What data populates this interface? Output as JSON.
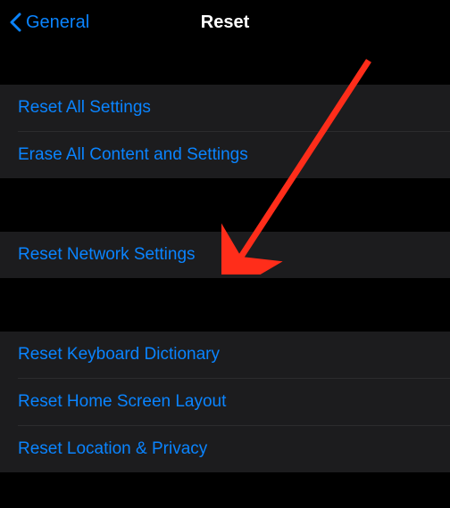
{
  "nav": {
    "back_label": "General",
    "title": "Reset"
  },
  "groups": [
    {
      "items": [
        {
          "label": "Reset All Settings"
        },
        {
          "label": "Erase All Content and Settings"
        }
      ]
    },
    {
      "items": [
        {
          "label": "Reset Network Settings"
        }
      ]
    },
    {
      "items": [
        {
          "label": "Reset Keyboard Dictionary"
        },
        {
          "label": "Reset Home Screen Layout"
        },
        {
          "label": "Reset Location & Privacy"
        }
      ]
    }
  ],
  "annotation": {
    "target": "reset-network-settings",
    "color": "#ff2d1a"
  }
}
